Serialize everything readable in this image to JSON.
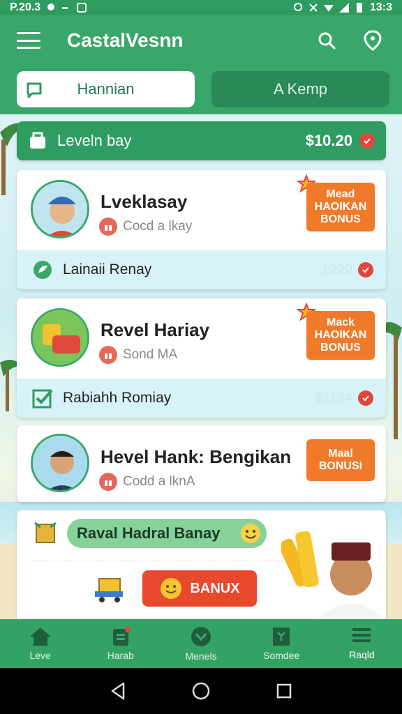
{
  "status_bar": {
    "time_left": "P.20.3",
    "time_right": "13:3"
  },
  "app_bar": {
    "title": "CastalVesnn"
  },
  "tabs": [
    {
      "label": "Hannian",
      "active": true
    },
    {
      "label": "A Kemp",
      "active": false
    }
  ],
  "balance": {
    "label": "Leveln bay",
    "amount": "$10.20"
  },
  "cards": [
    {
      "title": "Lveklasay",
      "subtitle": "Cocd a lkay",
      "bonus_lines": [
        "Mead",
        "HAOIKAN",
        "BONUS"
      ],
      "row_label": "Lainaii Renay",
      "row_value": "1229"
    },
    {
      "title": "Revel Hariay",
      "subtitle": "Sond MA",
      "bonus_lines": [
        "Mack",
        "HAOIKAN",
        "BONUS"
      ],
      "row_label": "Rabiahh Romiay",
      "row_value": "$1134"
    },
    {
      "title": "Hevel Hank: Bengikan",
      "subtitle": "Codd a lknA",
      "bonus_lines": [
        "Maal",
        "BONUSI"
      ]
    }
  ],
  "promo": {
    "pill_label": "Raval Hadral Banay",
    "button_label": "BANUX"
  },
  "bottom_nav": [
    {
      "label": "Leve",
      "icon": "home-icon"
    },
    {
      "label": "Harab",
      "icon": "clipboard-icon"
    },
    {
      "label": "Menels",
      "icon": "check-circle-icon"
    },
    {
      "label": "Somdee",
      "icon": "document-icon"
    },
    {
      "label": "Raqld",
      "icon": "list-icon"
    }
  ],
  "colors": {
    "primary": "#3aa76a",
    "accent": "#f07a2a",
    "danger": "#e0463b"
  }
}
